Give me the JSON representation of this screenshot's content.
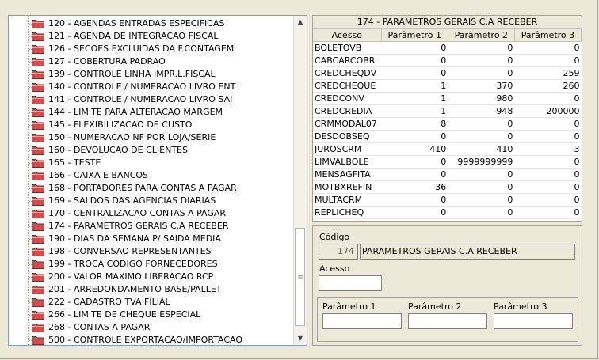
{
  "tree": {
    "items": [
      {
        "label": "120 - AGENDAS ENTRADAS ESPECIFICAS"
      },
      {
        "label": "121 - AGENDA DE INTEGRACAO FISCAL"
      },
      {
        "label": "126 - SECOES EXCLUIDAS DA F.CONTAGEM"
      },
      {
        "label": "127 - COBERTURA PADRAO"
      },
      {
        "label": "139 - CONTROLE LINHA IMPR.L.FISCAL"
      },
      {
        "label": "140 - CONTROLE / NUMERACAO LIVRO ENT"
      },
      {
        "label": "141 - CONTROLE / NUMERACAO LIVRO SAI"
      },
      {
        "label": "144 - LIMITE PARA ALTERACAO MARGEM"
      },
      {
        "label": "145 - FLEXIBILIZACAO DE CUSTO"
      },
      {
        "label": "150 - NUMERACAO NF POR LOJA/SERIE"
      },
      {
        "label": "160 - DEVOLUCAO DE CLIENTES"
      },
      {
        "label": "165 - TESTE"
      },
      {
        "label": "166 - CAIXA E BANCOS"
      },
      {
        "label": "168 - PORTADORES PARA CONTAS A PAGAR"
      },
      {
        "label": "169 - SALDOS DAS AGENCIAS DIARIAS"
      },
      {
        "label": "170 - CENTRALIZACAO CONTAS A PAGAR"
      },
      {
        "label": "174 - PARAMETROS GERAIS C.A RECEBER"
      },
      {
        "label": "190 - DIAS DA SEMANA P/ SAIDA MEDIA"
      },
      {
        "label": "198 - CONVERSAO REPRESENTANTES"
      },
      {
        "label": "199 - TROCA CODIGO FORNECEDORES"
      },
      {
        "label": "200 - VALOR MAXIMO LIBERACAO RCP"
      },
      {
        "label": "201 - ARREDONDAMENTO BASE/PALLET"
      },
      {
        "label": "222 - CADASTRO TVA FILIAL"
      },
      {
        "label": "266 - LIMITE DE CHEQUE ESPECIAL"
      },
      {
        "label": "268 - CONTAS A PAGAR"
      },
      {
        "label": "500 - CONTROLE EXPORTACAO/IMPORTACAO"
      }
    ]
  },
  "grid": {
    "title": "174 - PARAMETROS GERAIS C.A RECEBER",
    "columns": [
      "Acesso",
      "Parâmetro 1",
      "Parâmetro 2",
      "Parâmetro 3"
    ],
    "rows": [
      [
        "BOLETOVB",
        "0",
        "0",
        "0"
      ],
      [
        "CABCARCOBR",
        "0",
        "0",
        "0"
      ],
      [
        "CREDCHEQDV",
        "0",
        "0",
        "259"
      ],
      [
        "CREDCHEQUE",
        "1",
        "370",
        "260"
      ],
      [
        "CREDCONV",
        "1",
        "980",
        "0"
      ],
      [
        "CREDCREDIA",
        "1",
        "948",
        "200000"
      ],
      [
        "CRMMODAL07",
        "8",
        "0",
        "0"
      ],
      [
        "DESDOBSEQ",
        "0",
        "0",
        "0"
      ],
      [
        "JUROSCRM",
        "410",
        "410",
        "3"
      ],
      [
        "LIMVALBOLE",
        "0",
        "9999999999",
        "0"
      ],
      [
        "MENSAGFITA",
        "0",
        "0",
        "0"
      ],
      [
        "MOTBXREFIN",
        "36",
        "0",
        "0"
      ],
      [
        "MULTACRM",
        "0",
        "0",
        "0"
      ],
      [
        "REPLICHEQ",
        "0",
        "0",
        "0"
      ]
    ]
  },
  "form": {
    "codigo_label": "Código",
    "codigo_value": "174",
    "descricao_value": "PARAMETROS GERAIS C.A RECEBER",
    "acesso_label": "Acesso",
    "acesso_value": "",
    "param1_label": "Parâmetro 1",
    "param2_label": "Parâmetro 2",
    "param3_label": "Parâmetro 3",
    "param1_value": "",
    "param2_value": "",
    "param3_value": ""
  },
  "icons": {
    "folder": "folder-icon",
    "scroll_up": "scroll-up-arrow-icon",
    "scroll_down": "scroll-down-arrow-icon"
  },
  "colors": {
    "folder_fill": "#d24a4a",
    "folder_edge": "#8b1f1f",
    "window_bg": "#ece9d8"
  }
}
